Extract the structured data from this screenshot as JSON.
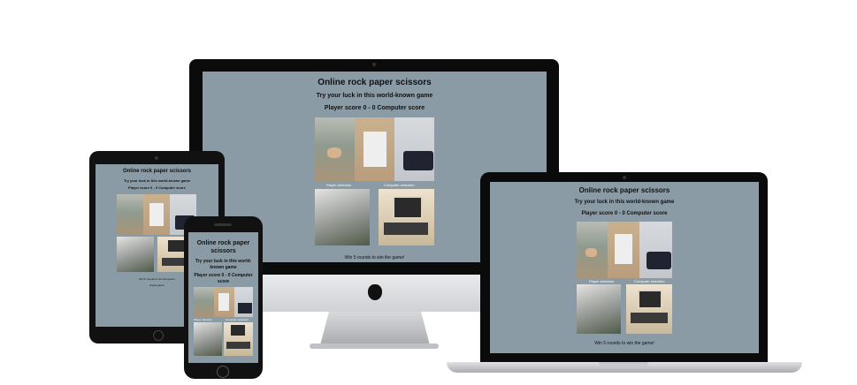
{
  "game": {
    "title": "Online rock paper scissors",
    "subtitle": "Try your luck in this world-known game",
    "score": "Player score 0 - 0 Computer score",
    "player_selection_label": "Player selection",
    "computer_selection_label": "Computer selection",
    "win_text": "Win 5 rounds to win the game!",
    "reset_label": "Reset game"
  },
  "tiles": {
    "rock": "rock",
    "paper": "paper",
    "scissors": "scissors"
  },
  "colors": {
    "screen_bg": "#8a9ba6",
    "device_frame": "#111111",
    "bezel_black": "#0c0c0c"
  }
}
